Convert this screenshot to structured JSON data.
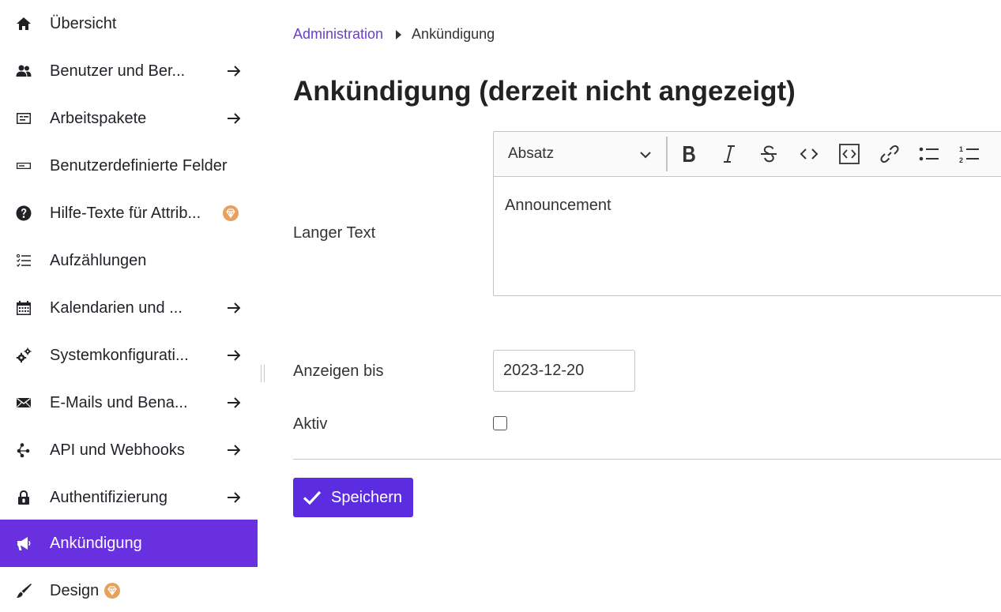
{
  "sidebar": {
    "items": [
      {
        "label": "Übersicht",
        "icon": "home-icon",
        "has_arrow": false
      },
      {
        "label": "Benutzer und Ber...",
        "icon": "users-icon",
        "has_arrow": true
      },
      {
        "label": "Arbeitspakete",
        "icon": "work-packages-icon",
        "has_arrow": true
      },
      {
        "label": "Benutzerdefinierte Felder",
        "icon": "custom-fields-icon",
        "has_arrow": false
      },
      {
        "label": "Hilfe-Texte für Attrib...",
        "icon": "help-icon",
        "has_arrow": false,
        "badge": "enterprise-badge-icon"
      },
      {
        "label": "Aufzählungen",
        "icon": "enumerations-icon",
        "has_arrow": false
      },
      {
        "label": "Kalendarien und ...",
        "icon": "calendar-icon",
        "has_arrow": true
      },
      {
        "label": "Systemkonfigurati...",
        "icon": "settings-icon",
        "has_arrow": true
      },
      {
        "label": "E-Mails und Bena...",
        "icon": "mail-icon",
        "has_arrow": true
      },
      {
        "label": "API und Webhooks",
        "icon": "api-icon",
        "has_arrow": true
      },
      {
        "label": "Authentifizierung",
        "icon": "lock-icon",
        "has_arrow": true
      },
      {
        "label": "Ankündigung",
        "icon": "megaphone-icon",
        "has_arrow": false,
        "active": true
      },
      {
        "label": "Design",
        "icon": "brush-icon",
        "has_arrow": false,
        "badge": "enterprise-badge-icon"
      }
    ],
    "active_color": "#6930e0"
  },
  "breadcrumb": {
    "parent": "Administration",
    "current": "Ankündigung"
  },
  "page": {
    "title": "Ankündigung (derzeit nicht angezeigt)"
  },
  "form": {
    "long_text_label": "Langer Text",
    "editor": {
      "paragraph_select": "Absatz",
      "toolbar_buttons": [
        "bold-icon",
        "italic-icon",
        "strikethrough-icon",
        "code-icon",
        "code-block-icon",
        "link-icon",
        "bulleted-list-icon",
        "numbered-list-icon"
      ],
      "content": "Announcement"
    },
    "show_until_label": "Anzeigen bis",
    "show_until_value": "2023-12-20",
    "active_label": "Aktiv",
    "active_checked": false,
    "save_label": "Speichern",
    "save_color": "#5b2ce0"
  }
}
